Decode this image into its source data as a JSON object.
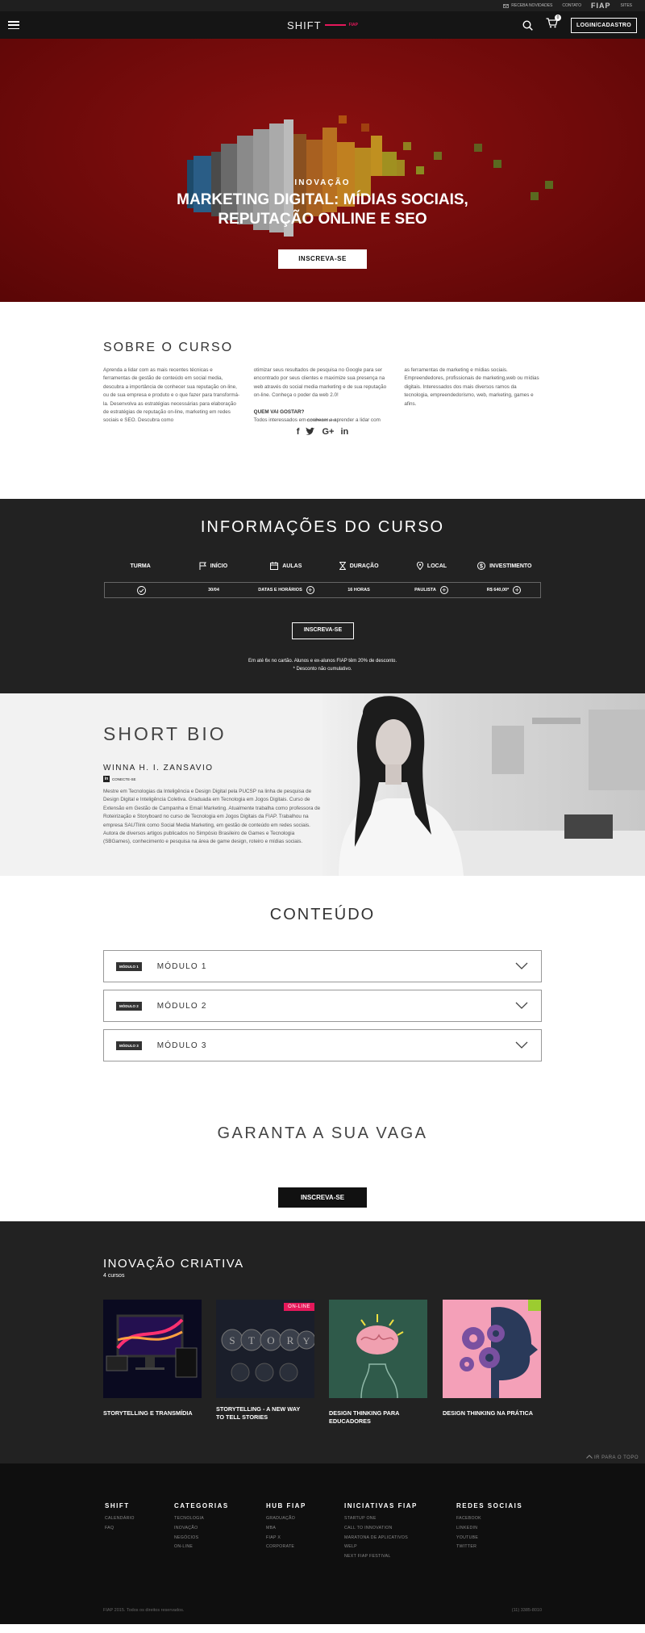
{
  "topbar": {
    "news": "RECEBA NOVIDADES",
    "contact": "CONTATO",
    "brand": "FIAP",
    "sites": "SITES"
  },
  "header": {
    "logo": "SHIFT",
    "logo_sub": "FIAP",
    "login": "LOGIN/CADASTRO",
    "cart_count": "0"
  },
  "hero": {
    "category": "INOVAÇÃO",
    "title_line1": "MARKETING DIGITAL: MÍDIAS SOCIAIS,",
    "title_line2": "REPUTAÇÃO ONLINE E SEO",
    "cta": "INSCREVA-SE"
  },
  "sobre": {
    "title": "SOBRE O CURSO",
    "col1": "Aprenda a lidar com as mais recentes técnicas e ferramentas de gestão de conteúdo em social media, descubra a importância de conhecer sua reputação on-line, ou de sua empresa e produto e o que fazer para transformá-la. Desenvolva as estratégias necessárias para elaboração de estratégias de reputação on-line, marketing em redes sociais e SEO. Descubra como",
    "col2": "otimizar seus resultados de pesquisa no Google para ser encontrado por seus clientes e maximize sua presença na web através do social media marketing e de sua reputação on-line. Conheça o poder da web 2.0!",
    "col2_q": "QUEM VAI GOSTAR?",
    "col2_b": "Todos interessados em conhecer e aprender a lidar com",
    "col3": "as ferramentas de marketing e mídias sociais. Empreendedores, profissionais de marketing,web ou mídias digitais. Interessados dos mais diversos ramos da tecnologia, empreendedorismo, web, marketing, games e afins.",
    "share_label": "COMPARTILHE:"
  },
  "info": {
    "title": "INFORMAÇÕES DO CURSO",
    "headers": [
      "TURMA",
      "INÍCIO",
      "AULAS",
      "DURAÇÃO",
      "LOCAL",
      "INVESTIMENTO"
    ],
    "values": [
      "",
      "30/04",
      "DATAS E HORÁRIOS",
      "16 HORAS",
      "PAULISTA",
      "R$ 640,00*"
    ],
    "cta": "INSCREVA-SE",
    "note1": "Em até 6x no cartão. Alunos e ex-alunos FIAP têm 20% de desconto.",
    "note2": "* Desconto não cumulativo."
  },
  "bio": {
    "title": "SHORT BIO",
    "name": "WINNA H. I. ZANSAVIO",
    "linkedin": "CONECTE-SE",
    "text": "Mestre em Tecnologias da Inteligência e Design Digital pela PUCSP na linha de pesquisa de Design Digital e Inteligência Coletiva. Graduada em Tecnologia em Jogos Digitais. Curso de Extensão em Gestão de Campanha e Email Marketing. Atualmente trabalha como professora de Roteirização e Storyboard no curso de Tecnologia em Jogos Digitais da FIAP. Trabalhou na empresa SAUTlink como Social Media Marketing, em gestão de conteúdo em redes sociais. Autora de diversos artigos publicados no Simpósio Brasileiro de Games e Tecnologia (SBGames), conhecimento e pesquisa na área de game design, roteiro e mídias sociais."
  },
  "conteudo": {
    "title": "CONTEÚDO",
    "modules": [
      {
        "tag": "MÓDULO 1",
        "title": "MÓDULO 1"
      },
      {
        "tag": "MÓDULO 2",
        "title": "MÓDULO 2"
      },
      {
        "tag": "MÓDULO 3",
        "title": "MÓDULO 3"
      }
    ]
  },
  "garanta": {
    "title": "GARANTA A SUA VAGA",
    "cta": "INSCREVA-SE"
  },
  "criativa": {
    "title": "INOVAÇÃO CRIATIVA",
    "count": "4 cursos",
    "cards": [
      {
        "title_1": "STORYTELLING E TRANSMÍDIA",
        "title_2": ""
      },
      {
        "title_1": "STORYTELLING - A NEW WAY",
        "title_2": "TO TELL STORIES",
        "badge": "ON-LINE"
      },
      {
        "title_1": "DESIGN THINKING PARA",
        "title_2": "EDUCADORES"
      },
      {
        "title_1": "DESIGN THINKING NA PRÁTICA",
        "title_2": ""
      }
    ]
  },
  "footer": {
    "to_top": "IR PARA O TOPO",
    "shift": {
      "title": "SHIFT",
      "items": [
        "CALENDÁRIO",
        "FAQ"
      ]
    },
    "categorias": {
      "title": "CATEGORIAS",
      "items": [
        "TECNOLOGIA",
        "INOVAÇÃO",
        "NEGÓCIOS",
        "ON-LINE"
      ]
    },
    "hub": {
      "title": "HUB FIAP",
      "items": [
        "GRADUAÇÃO",
        "MBA",
        "FIAP X",
        "CORPORATE"
      ]
    },
    "iniciativas": {
      "title": "INICIATIVAS FIAP",
      "items": [
        "STARTUP ONE",
        "CALL TO INNOVATION",
        "MARATONA DE APLICATIVOS",
        "WELP",
        "NEXT FIAP FESTIVAL"
      ]
    },
    "redes": {
      "title": "REDES SOCIAIS",
      "items": [
        "FACEBOOK",
        "LINKEDIN",
        "YOUTUBE",
        "TWITTER"
      ]
    },
    "copyright": "FIAP 2015. Todos os direitos reservados.",
    "phone": "(11) 3385-8010"
  },
  "colors": {
    "accent": "#e5185b",
    "dark": "#222222",
    "hero": "#7a0c0c"
  }
}
